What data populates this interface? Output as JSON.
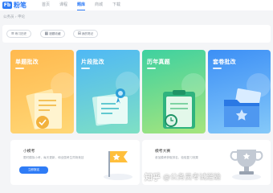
{
  "app": {
    "logo_mark": "Fb",
    "logo_text": "粉笔"
  },
  "nav": [
    {
      "label": "首页",
      "active": false
    },
    {
      "label": "课程",
      "active": false
    },
    {
      "label": "题库",
      "active": true
    },
    {
      "label": "商城",
      "active": false
    },
    {
      "label": "下载",
      "active": false
    }
  ],
  "breadcrumb": "公务员 › 申论",
  "toolbar": {
    "buttons": [
      {
        "icon": "≡",
        "icon_name": "record-icon",
        "label": "练习历史"
      },
      {
        "icon": "▦",
        "icon_name": "error-book-icon",
        "label": "错题收藏"
      },
      {
        "icon": "⊞",
        "icon_name": "collection-icon",
        "label": "我的笔记"
      }
    ]
  },
  "cards": [
    {
      "title": "单题批改",
      "color": "#ffb94e"
    },
    {
      "title": "片段批改",
      "color": "#4fb8f5"
    },
    {
      "title": "历年真题",
      "color": "#3ed1a0"
    },
    {
      "title": "套卷批改",
      "color": "#3c8ff6"
    }
  ],
  "panels": {
    "left": {
      "title": "小模考",
      "desc": "限时模拟小考，每天更新，和全国考生同场竞技",
      "button": "立即报名"
    },
    "right": {
      "title": "模考大赛",
      "desc": "参加模考获取排名，检验复习效果"
    }
  },
  "watermark": {
    "brand": "知乎",
    "text": "@公务员考试经验"
  },
  "colors": {
    "accent": "#2f7cf6",
    "background": "#f4f5f7"
  }
}
